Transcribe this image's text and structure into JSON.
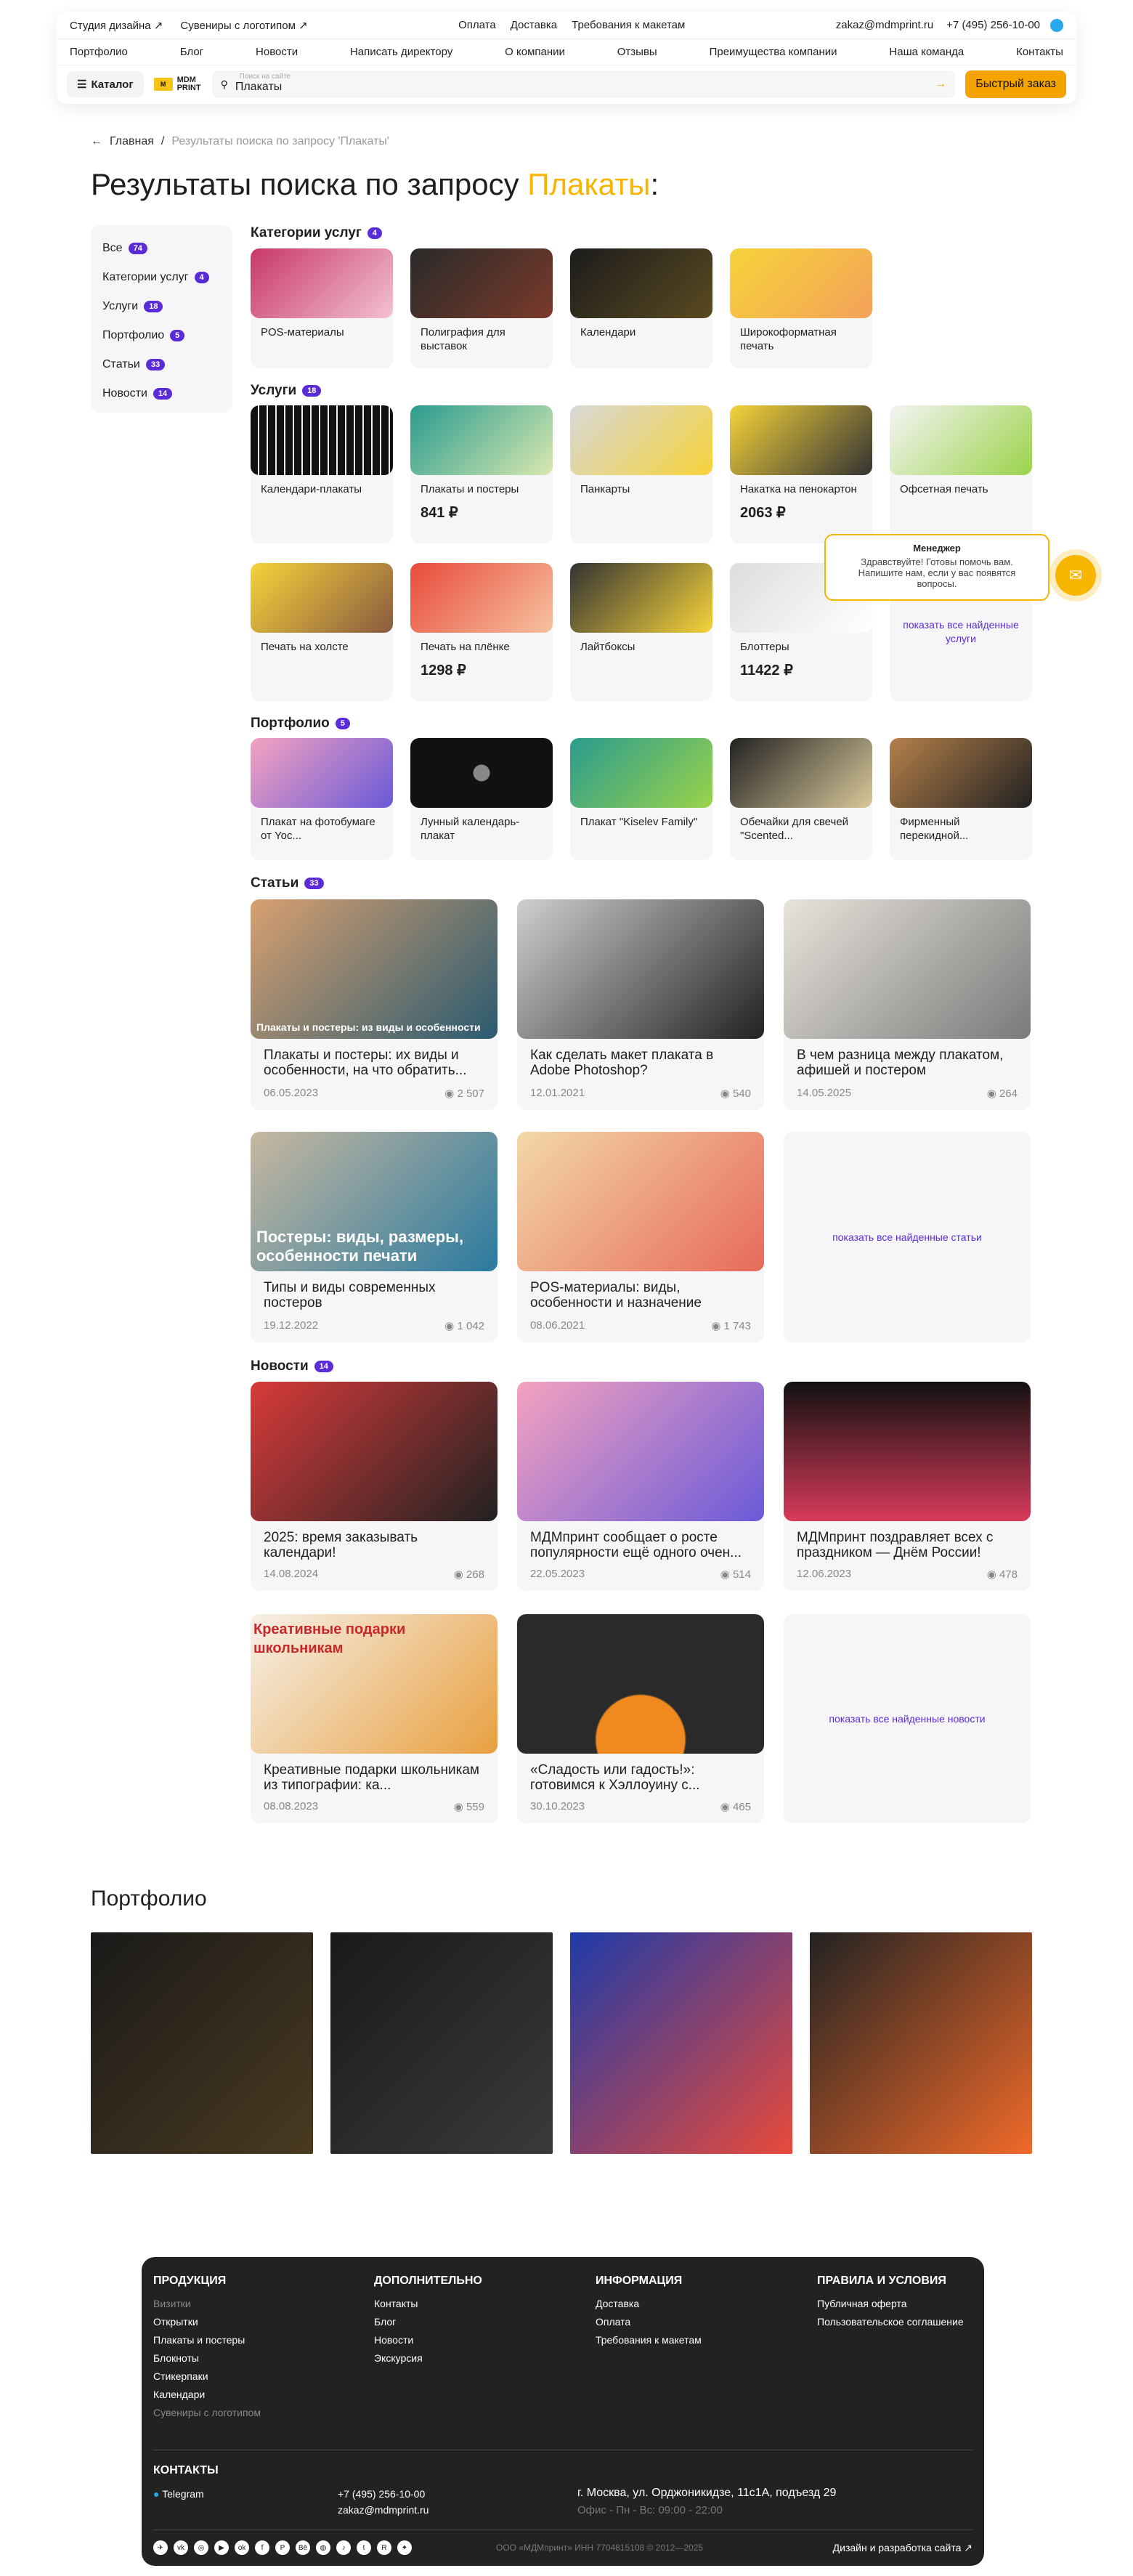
{
  "header": {
    "top_links": [
      "Студия дизайна ↗",
      "Сувениры с логотипом ↗"
    ],
    "mid_links": [
      "Оплата",
      "Доставка",
      "Требования к макетам"
    ],
    "email": "zakaz@mdmprint.ru",
    "phone": "+7 (495) 256-10-00",
    "nav": [
      "Портфолио",
      "Блог",
      "Новости",
      "Написать директору",
      "О компании",
      "Отзывы",
      "Преимущества компании",
      "Наша команда",
      "Контакты"
    ],
    "catalog": "Каталог",
    "logo": "MDM PRINT",
    "search_placeholder": "Поиск на сайте",
    "search_value": "Плакаты",
    "quick_order": "Быстрый заказ"
  },
  "breadcrumb": {
    "home": "Главная",
    "current": "Результаты поиска по запросу 'Плакаты'"
  },
  "title": {
    "text": "Результаты поиска по запросу ",
    "query": "Плакаты",
    "colon": ":"
  },
  "sidebar": [
    {
      "label": "Все",
      "count": "74"
    },
    {
      "label": "Категории услуг",
      "count": "4"
    },
    {
      "label": "Услуги",
      "count": "18"
    },
    {
      "label": "Портфолио",
      "count": "5"
    },
    {
      "label": "Статьи",
      "count": "33"
    },
    {
      "label": "Новости",
      "count": "14"
    }
  ],
  "sections": {
    "categories": {
      "title": "Категории услуг",
      "count": "4",
      "items": [
        "POS-материалы",
        "Полиграфия для выставок",
        "Календари",
        "Широкоформатная печать"
      ]
    },
    "services": {
      "title": "Услуги",
      "count": "18",
      "items": [
        {
          "t": "Календари-плакаты",
          "p": ""
        },
        {
          "t": "Плакаты и постеры",
          "p": "841 ₽"
        },
        {
          "t": "Панкарты",
          "p": ""
        },
        {
          "t": "Накатка на пенокартон",
          "p": "2063 ₽"
        },
        {
          "t": "Офсетная печать",
          "p": ""
        },
        {
          "t": "Печать на холсте",
          "p": ""
        },
        {
          "t": "Печать на плёнке",
          "p": "1298 ₽"
        },
        {
          "t": "Лайтбоксы",
          "p": ""
        },
        {
          "t": "Блоттеры",
          "p": "11422 ₽"
        }
      ],
      "showall": "показать все найденные услуги"
    },
    "portfolio": {
      "title": "Портфолио",
      "count": "5",
      "items": [
        "Плакат на фотобумаге от Yoc...",
        "Лунный календарь-плакат",
        "Плакат \"Kiselev Family\"",
        "Обечайки для свечей \"Scented...",
        "Фирменный перекидной..."
      ]
    },
    "articles": {
      "title": "Статьи",
      "count": "33",
      "items": [
        {
          "t": "Плакаты и постеры: их виды и особенности, на что обратить...",
          "d": "06.05.2023",
          "v": "2 507",
          "ov": "Плакаты и постеры: из виды и особенности"
        },
        {
          "t": "Как сделать макет плаката в Adobe Photoshop?",
          "d": "12.01.2021",
          "v": "540",
          "ov": ""
        },
        {
          "t": "В чем разница между плакатом, афишей и постером",
          "d": "14.05.2025",
          "v": "264",
          "ov": ""
        },
        {
          "t": "Типы и виды современных постеров",
          "d": "19.12.2022",
          "v": "1 042",
          "ov": "Постеры: виды, размеры, особенности печати"
        },
        {
          "t": "POS-материалы: виды, особенности и назначение",
          "d": "08.06.2021",
          "v": "1 743",
          "ov": ""
        }
      ],
      "showall": "показать все найденные статьи"
    },
    "news": {
      "title": "Новости",
      "count": "14",
      "items": [
        {
          "t": "2025: время заказывать календари!",
          "d": "14.08.2024",
          "v": "268",
          "ov": ""
        },
        {
          "t": "МДМпринт сообщает о росте популярности ещё одного очен...",
          "d": "22.05.2023",
          "v": "514",
          "ov": ""
        },
        {
          "t": "МДМпринт поздравляет всех с праздником — Днём России!",
          "d": "12.06.2023",
          "v": "478",
          "ov": ""
        },
        {
          "t": "Креативные подарки школьникам из типографии: ка...",
          "d": "08.08.2023",
          "v": "559",
          "ov": "Креативные подарки школьникам"
        },
        {
          "t": "«Сладость или гадость!»: готовимся к Хэллоуину с...",
          "d": "30.10.2023",
          "v": "465",
          "ov": ""
        }
      ],
      "showall": "показать все найденные новости"
    }
  },
  "portfolio_title": "Портфолио",
  "chat": {
    "title": "Менеджер",
    "text": "Здравствуйте! Готовы помочь вам. Напишите нам, если у вас появятся вопросы."
  },
  "footer": {
    "c1": {
      "h": "ПРОДУКЦИЯ",
      "items": [
        "Визитки",
        "Открытки",
        "Плакаты и постеры",
        "Блокноты",
        "Стикерпаки",
        "Календари",
        "Сувениры с логотипом"
      ]
    },
    "c2": {
      "h": "ДОПОЛНИТЕЛЬНО",
      "items": [
        "Контакты",
        "Блог",
        "Новости",
        "Экскурсия"
      ]
    },
    "c3": {
      "h": "ИНФОРМАЦИЯ",
      "items": [
        "Доставка",
        "Оплата",
        "Требования к макетам"
      ]
    },
    "c4": {
      "h": "ПРАВИЛА И УСЛОВИЯ",
      "items": [
        "Публичная оферта",
        "Пользовательское соглашение"
      ]
    },
    "contacts": "КОНТАКТЫ",
    "telegram": "Telegram",
    "phone": "+7 (495) 256-10-00",
    "email": "zakaz@mdmprint.ru",
    "address": "г. Москва, ул. Орджоникидзе, 11с1А, подъезд 29",
    "hours": "Офис - Пн - Вс: 09:00 - 22:00",
    "legal": "ООО «МДМпринт»   ИНН 7704815108   © 2012—2025",
    "design": "Дизайн и разработка сайта ↗"
  }
}
